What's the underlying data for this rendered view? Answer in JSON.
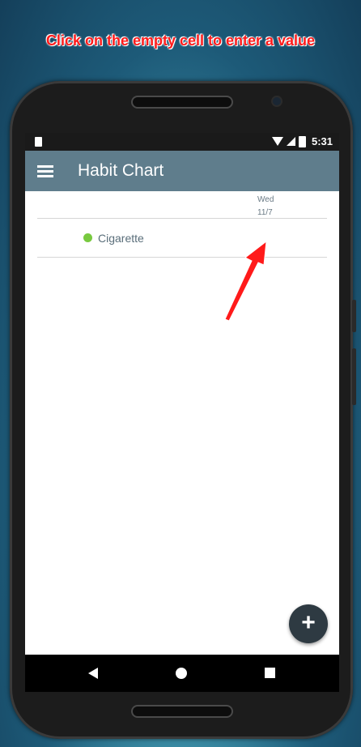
{
  "caption": "Click on the empty cell to enter a value",
  "status_bar": {
    "time": "5:31"
  },
  "app_bar": {
    "title": "Habit Chart"
  },
  "chart": {
    "columns": [
      {
        "day": "Wed",
        "date": "11/7"
      }
    ],
    "habits": [
      {
        "name": "Cigarette",
        "color": "#78c93f",
        "values": [
          ""
        ]
      }
    ]
  },
  "fab": {
    "label": "+"
  },
  "colors": {
    "appbar": "#5f7d8c",
    "fab": "#2e3a42",
    "caption": "#ff1a1a",
    "arrow": "#ff1a1a"
  },
  "icons": [
    "menu-icon",
    "sim-card-icon",
    "wifi-icon",
    "signal-icon",
    "battery-icon",
    "nav-back-icon",
    "nav-home-icon",
    "nav-recents-icon",
    "add-icon",
    "arrow-pointer-icon"
  ]
}
